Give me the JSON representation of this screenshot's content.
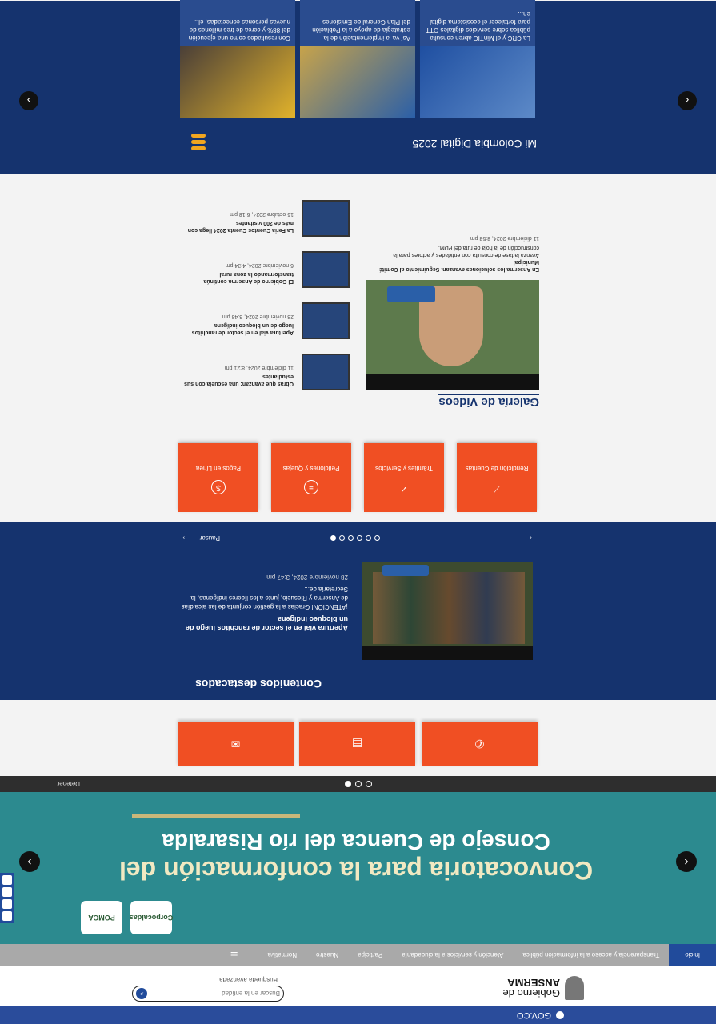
{
  "gov_bar": {
    "label": "GOV.CO"
  },
  "header": {
    "logo_line1": "Gobierno de",
    "logo_line2": "ANSERMA",
    "search_placeholder": "Buscar en la entidad",
    "search_advanced": "Búsqueda avanzada"
  },
  "nav": {
    "items": [
      "Inicio",
      "Transparencia y acceso a la información pública",
      "Atención y servicios a la ciudadanía",
      "Participa",
      "Nuestro",
      "Normativa",
      "Información de la entidad"
    ]
  },
  "hero": {
    "title_line1": "Convocatoria para la conformación del",
    "title_line2": "Consejo de Cuenca del río Risaralda",
    "logo1": "Corpocaldas",
    "logo2": "POMCA",
    "pause": "Detener"
  },
  "featured": {
    "title": "Contenidos destacados",
    "item_title": "Apertura vial en el sector de ranchitos luego de un bloqueo indígena",
    "item_text": "¡ATENCIÓN! Gracias a la gestión conjunta de las alcaldías de Anserma y Riosucio, junto a los líderes indígenas, la Secretaría de...",
    "item_date": "28 noviembre 2024, 3:47 pm",
    "pause": "Pausar"
  },
  "services": [
    {
      "label": "Pagos en Línea",
      "icon": "dollar-icon"
    },
    {
      "label": "Peticiones y Quejas",
      "icon": "document-icon"
    },
    {
      "label": "Trámites y Servicios",
      "icon": "check-icon"
    },
    {
      "label": "Rendición de Cuentas",
      "icon": "chart-icon"
    }
  ],
  "videos": {
    "title": "Galería de Videos",
    "main": {
      "title": "En Anserma los soluciones avanzan. Seguimiento al Comité Municipal",
      "text": "Avanza la fase de consulta con entidades y actores para la construcción de la hoja de ruta del PDM.",
      "date": "11 diciembre 2024, 8:58 pm"
    },
    "items": [
      {
        "title": "Obras que avanzan: una escuela con sus estudiantes",
        "date": "11 diciembre 2024, 8:21 pm"
      },
      {
        "title": "Apertura vial en el sector de ranchitos luego de un bloqueo indígena",
        "date": "28 noviembre 2024, 3:48 pm"
      },
      {
        "title": "El Gobierno de Anserma continúa transformando la zona rural",
        "date": "6 noviembre 2024, 4:34 pm"
      },
      {
        "title": "La Feria Cuentos Cuenta 2024 llega con más de 200 visitantes",
        "date": "16 octubre 2024, 6:18 pm"
      }
    ]
  },
  "mcd": {
    "title": "Mi Colombia Digital 2025",
    "cards": [
      {
        "text": "La CRC y el MinTIC abren consulta pública sobre servicios digitales OTT para fortalecer el ecosistema digital en..."
      },
      {
        "text": "Así va la implementación de la estrategia de apoyo a la Población del Plan General de Emisiones"
      },
      {
        "text": "Con resultados como una ejecución del 88% y cerca de tres millones de nuevas personas conectadas, el..."
      }
    ]
  }
}
